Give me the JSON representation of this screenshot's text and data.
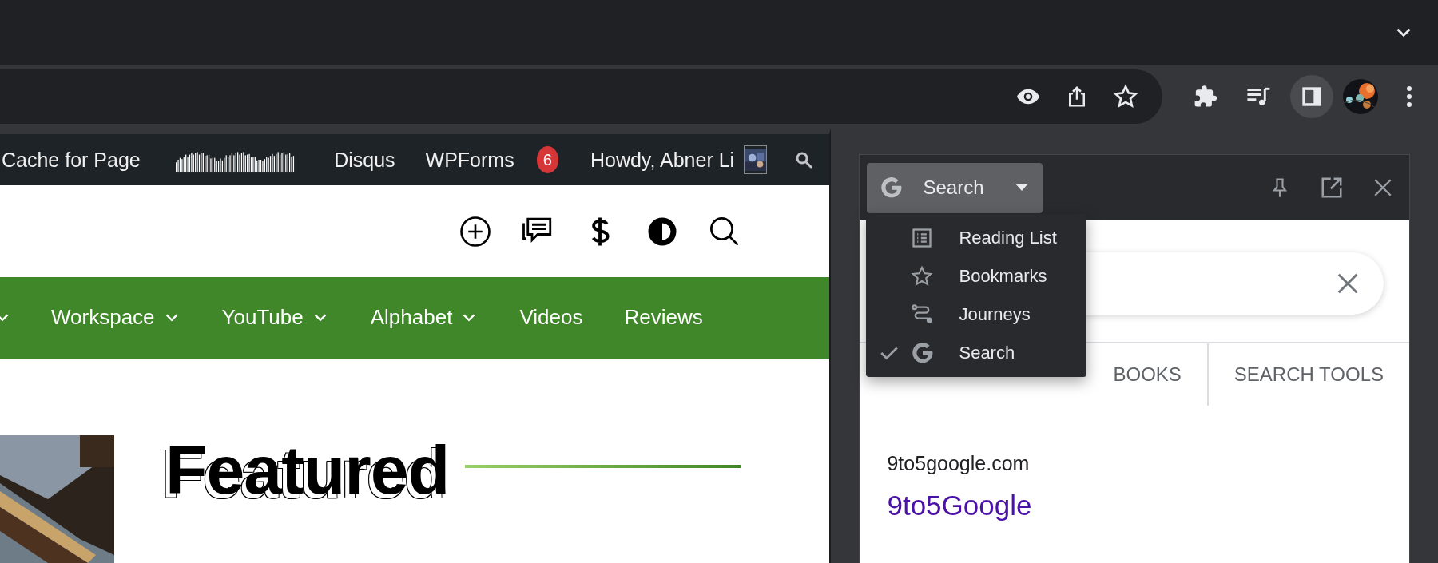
{
  "toolbar": {
    "side_panel_button": {
      "selected": true
    }
  },
  "admin_bar": {
    "items": [
      {
        "kind": "text",
        "label": "Cache for Page"
      },
      {
        "kind": "waveform"
      },
      {
        "kind": "text",
        "label": "Disqus"
      },
      {
        "kind": "text",
        "label": "WPForms",
        "badge": "6"
      },
      {
        "kind": "user",
        "label": "Howdy, Abner Li"
      }
    ]
  },
  "site_nav": {
    "items": [
      {
        "has_dropdown": true
      },
      {
        "label": "Workspace",
        "has_dropdown": true
      },
      {
        "label": "YouTube",
        "has_dropdown": true
      },
      {
        "label": "Alphabet",
        "has_dropdown": true
      },
      {
        "label": "Videos",
        "has_dropdown": false
      },
      {
        "label": "Reviews",
        "has_dropdown": false
      }
    ]
  },
  "featured": {
    "heading": "Featured"
  },
  "side_panel": {
    "selector": {
      "label": "Search"
    },
    "menu": {
      "items": [
        {
          "label": "Reading List",
          "selected": false
        },
        {
          "label": "Bookmarks",
          "selected": false
        },
        {
          "label": "Journeys",
          "selected": false
        },
        {
          "label": "Search",
          "selected": true
        }
      ]
    },
    "search_tabs": [
      {
        "label": "BOOKS"
      },
      {
        "label": "SEARCH TOOLS"
      }
    ],
    "result": {
      "site": "9to5google.com",
      "title": "9to5Google"
    }
  }
}
